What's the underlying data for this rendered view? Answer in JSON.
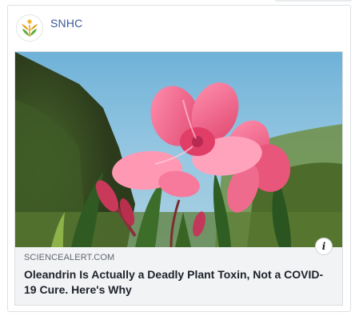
{
  "post": {
    "page_name": "SNHC",
    "avatar_icon": "snhc-logo-icon"
  },
  "link_preview": {
    "domain": "SCIENCEALERT.COM",
    "headline": "Oleandrin Is Actually a Deadly Plant Toxin, Not a COVID-19 Cure. Here's Why",
    "image_subject": "oleander-flowers-photo",
    "info_icon": "info-icon",
    "info_glyph": "i"
  },
  "colors": {
    "page_name": "#385898",
    "domain": "#606770",
    "headline": "#1d2129",
    "preview_bg": "#f2f3f5"
  }
}
